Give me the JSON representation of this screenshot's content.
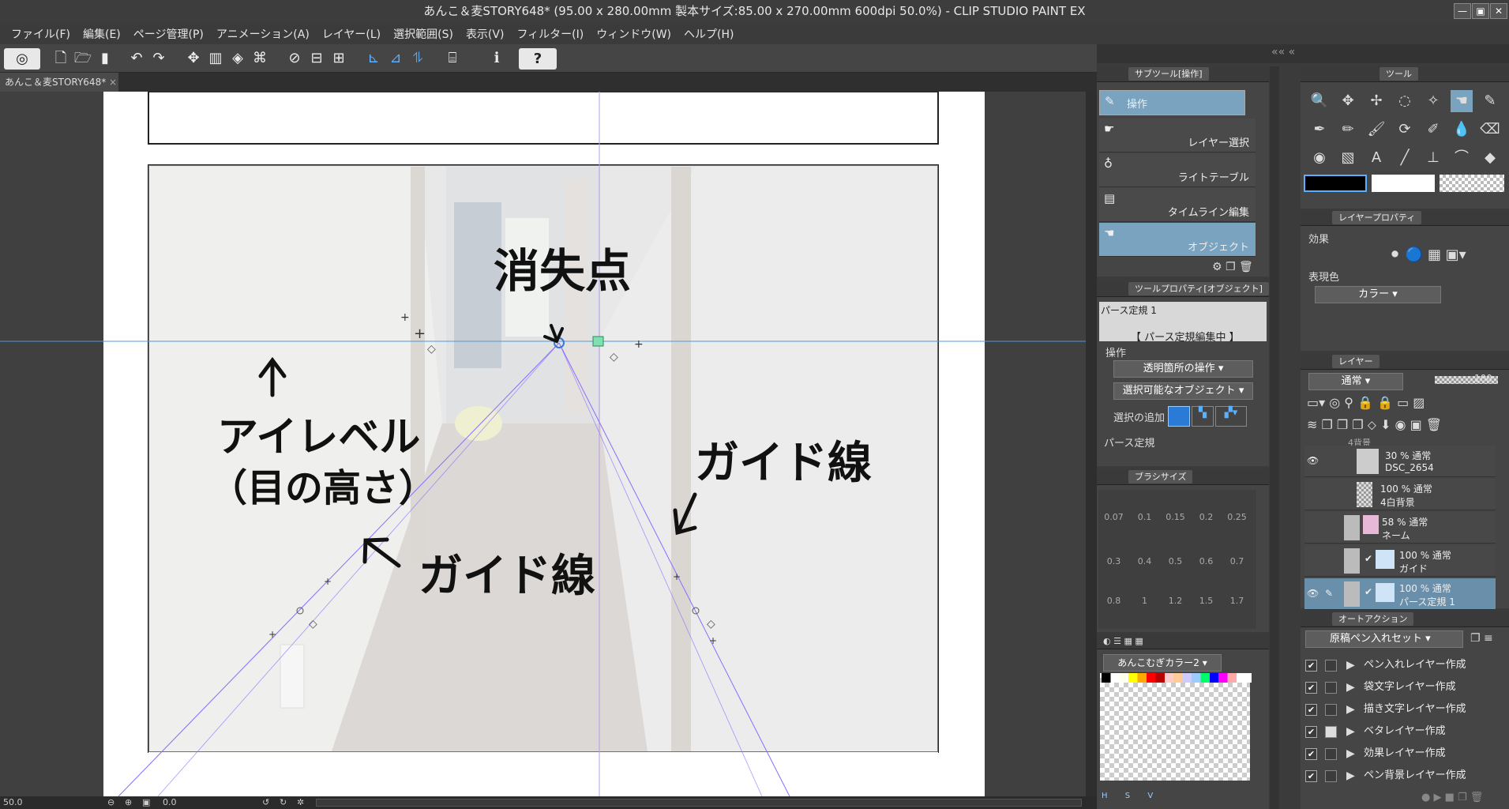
{
  "window": {
    "title": "あんこ＆麦STORY648* (95.00 x 280.00mm 製本サイズ:85.00 x 270.00mm 600dpi 50.0%)  - CLIP STUDIO PAINT EX"
  },
  "menu": [
    "ファイル(F)",
    "編集(E)",
    "ページ管理(P)",
    "アニメーション(A)",
    "レイヤー(L)",
    "選択範囲(S)",
    "表示(V)",
    "フィルター(I)",
    "ウィンドウ(W)",
    "ヘルプ(H)"
  ],
  "doc_tab": {
    "label": "あんこ＆麦STORY648*"
  },
  "canvas": {
    "annotation_vanishing": "消失点",
    "annotation_eyelevel_1": "アイレベル",
    "annotation_eyelevel_2": "（目の高さ）",
    "annotation_guide_right": "ガイド線",
    "annotation_guide_left": "ガイド線"
  },
  "status": {
    "zoom": "50.0",
    "angle": "0.0"
  },
  "subtool": {
    "header": "サブツール[操作]",
    "items": [
      {
        "label": "操作",
        "selected": true
      },
      {
        "label": "レイヤー選択"
      },
      {
        "label": "ライトテーブル"
      },
      {
        "label": "タイムライン編集"
      },
      {
        "label": "オブジェクト",
        "selected": true
      }
    ]
  },
  "toolprop": {
    "header": "ツールプロパティ[オブジェクト]",
    "object_name": "パース定規 1",
    "editing_badge": "【 パース定規編集中 】",
    "section_operation": "操作",
    "transparent_op": "透明箇所の操作",
    "selectable_obj": "選択可能なオブジェクト",
    "add_selection": "選択の追加",
    "section_perspective": "パース定規"
  },
  "brushsize": {
    "header": "ブラシサイズ",
    "rows": [
      [
        "0.07",
        "0.1",
        "0.15",
        "0.2",
        "0.25"
      ],
      [
        "0.3",
        "0.4",
        "0.5",
        "0.6",
        "0.7"
      ],
      [
        "0.8",
        "1",
        "1.2",
        "1.5",
        "1.7"
      ]
    ]
  },
  "colorset": {
    "name": "あんこむぎカラー2",
    "bottom_labels": [
      "H",
      "S",
      "V"
    ]
  },
  "tools": {
    "header": "ツール"
  },
  "layerprop": {
    "header": "レイヤープロパティ",
    "effect_label": "効果",
    "expression_label": "表現色",
    "expression_value": "カラー"
  },
  "layers": {
    "header": "レイヤー",
    "blend_mode": "通常",
    "opacity": "100",
    "top_partial": "4背景",
    "rows": [
      {
        "line1": "30 % 通常",
        "line2": "DSC_2654"
      },
      {
        "line1": "100 % 通常",
        "line2": "4白背景"
      },
      {
        "line1": "58 % 通常",
        "line2": "ネーム"
      },
      {
        "line1": "100 % 通常",
        "line2": "ガイド"
      },
      {
        "line1": "100 % 通常",
        "line2": "パース定規 1"
      }
    ]
  },
  "autoaction": {
    "header": "オートアクション",
    "set_name": "原稿ペン入れセット",
    "items": [
      "ペン入れレイヤー作成",
      "袋文字レイヤー作成",
      "描き文字レイヤー作成",
      "ベタレイヤー作成",
      "効果レイヤー作成",
      "ペン背景レイヤー作成"
    ]
  },
  "colors": {
    "accent": "#6a8fab",
    "guide_line": "#8a6cff",
    "eye_level": "#4f9ad8",
    "panel_bg": "#454545"
  }
}
